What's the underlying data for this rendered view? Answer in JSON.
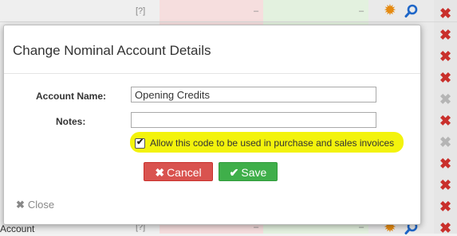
{
  "background": {
    "top_row": {
      "col_a_ref": "[?]",
      "col_b": "–",
      "col_c": "–"
    },
    "bottom_row": {
      "account_label": "Account",
      "col_a_ref": "[?]",
      "col_b": "–",
      "col_c": "–"
    },
    "delete_icons": [
      "red",
      "red",
      "red",
      "red",
      "grey",
      "red",
      "grey",
      "red",
      "red",
      "red",
      "red"
    ]
  },
  "modal": {
    "title": "Change Nominal Account Details",
    "account_name_label": "Account Name:",
    "account_name_value": "Opening Credits",
    "notes_label": "Notes:",
    "notes_value": "",
    "allow_checkbox": {
      "checked": true,
      "label": "Allow this code to be used in purchase and sales invoices"
    },
    "cancel_label": "Cancel",
    "save_label": "Save",
    "close_label": "Close"
  },
  "colors": {
    "cancel": "#d9534f",
    "save": "#3faf4a",
    "highlight": "#f3f30c",
    "delete": "#c9302c",
    "gear": "#e58a11",
    "search": "#1e66c8"
  }
}
